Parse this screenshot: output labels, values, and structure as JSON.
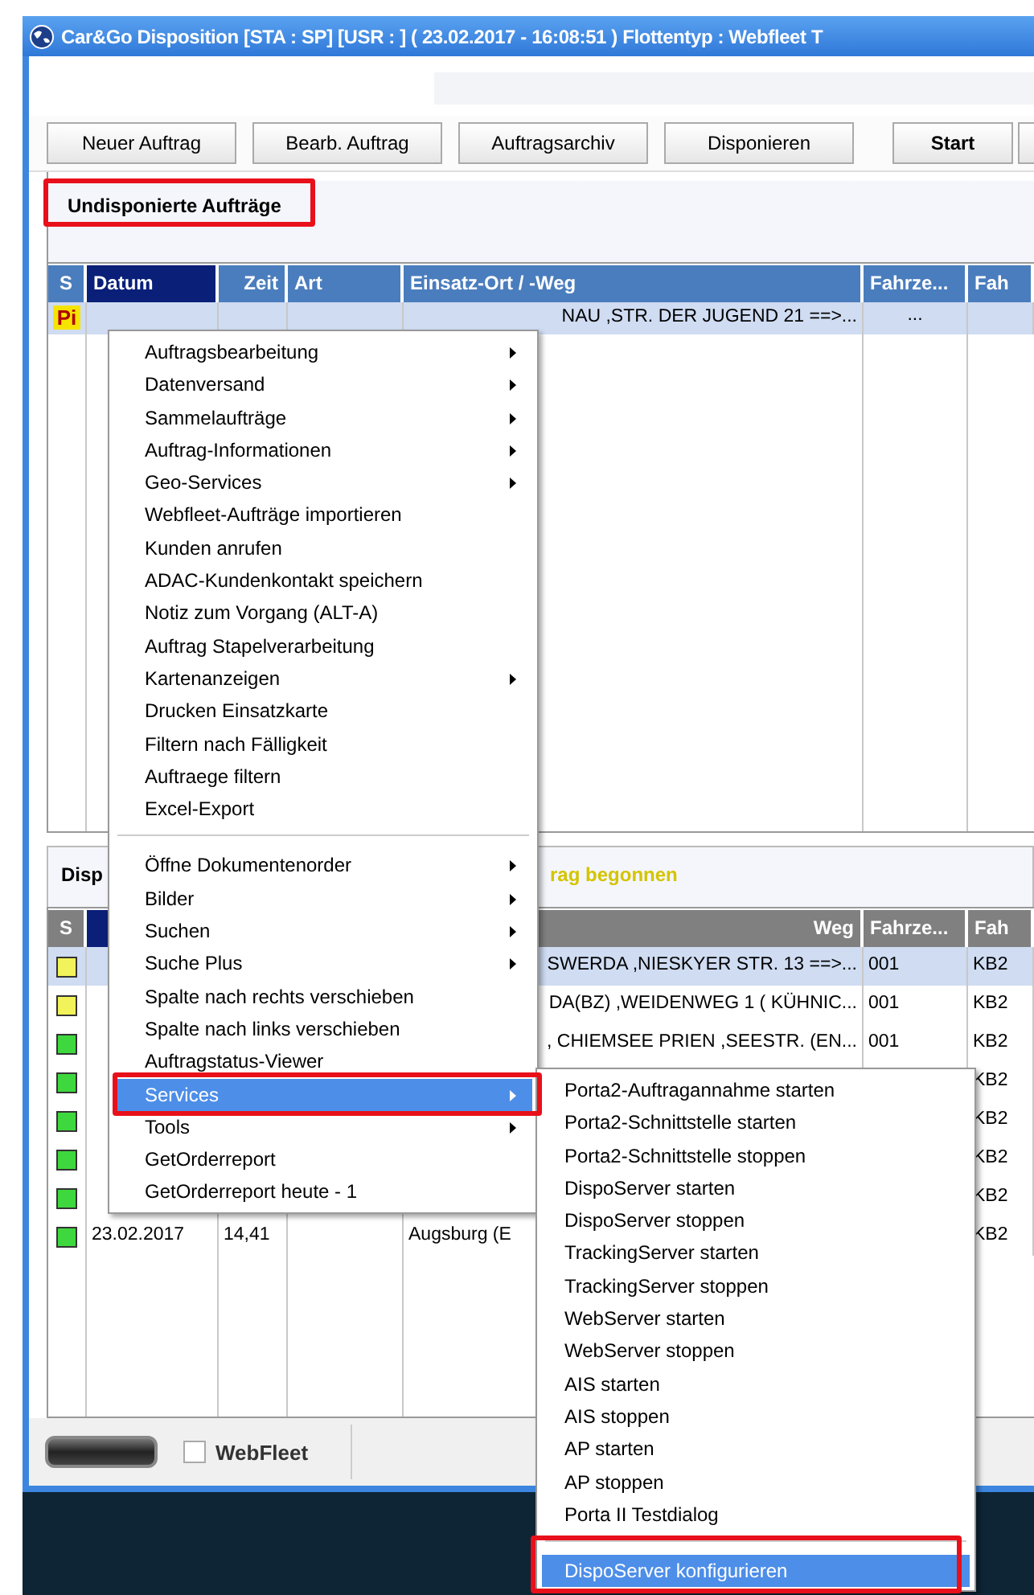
{
  "window": {
    "title": "Car&Go Disposition   [STA : SP]  [USR : ] ( 23.02.2017 - 16:08:51 ) Flottentyp : Webfleet T"
  },
  "toolbar": [
    {
      "label": "Neuer Auftrag",
      "kind": "normal"
    },
    {
      "label": "Bearb. Auftrag",
      "kind": "normal"
    },
    {
      "label": "Auftragsarchiv",
      "kind": "normal"
    },
    {
      "label": "Disponieren",
      "kind": "normal"
    },
    {
      "label": "Start",
      "kind": "primary"
    }
  ],
  "undispatched": {
    "title": "Undisponierte Aufträge",
    "columns": [
      {
        "label": "S",
        "selected": false
      },
      {
        "label": "Datum",
        "selected": true
      },
      {
        "label": "Zeit",
        "selected": false
      },
      {
        "label": "Art",
        "selected": false
      },
      {
        "label": "Einsatz-Ort / -Weg",
        "selected": false
      },
      {
        "label": "Fahrze...",
        "selected": false
      },
      {
        "label": "Fah",
        "selected": false
      }
    ],
    "rows": [
      {
        "status": "Pi",
        "ort": "NAU ,STR. DER JUGEND 21 ==>...",
        "fahrzeug": "...",
        "selected": true
      }
    ]
  },
  "dispatched": {
    "title": "Disp",
    "subtitle": "rag begonnen",
    "columns": [
      {
        "label": "S",
        "selected": false
      },
      {
        "selected": true
      },
      {},
      {},
      {
        "label": "Weg",
        "selected": false
      },
      {
        "label": "Fahrze...",
        "selected": false
      },
      {
        "label": "Fah",
        "selected": false
      }
    ],
    "rows": [
      {
        "color": "#f2f25a",
        "ort": "SWERDA ,NIESKYER STR. 13 ==>...",
        "fahrzeug": "001",
        "column_7": "KB2",
        "selected": true
      },
      {
        "color": "#f2f25a",
        "ort": "DA(BZ) ,WEIDENWEG 1 ( KÜHNIC...",
        "fahrzeug": "001",
        "column_7": "KB2",
        "selected": false
      },
      {
        "color": "#3ed83e",
        "ort": ", CHIEMSEE PRIEN ,SEESTR. (EN...",
        "fahrzeug": "001",
        "column_7": "KB2",
        "selected": false
      },
      {
        "color": "#3ed83e",
        "column_7": "KB2",
        "selected": false
      },
      {
        "color": "#3ed83e",
        "column_7": "KB2",
        "selected": false
      },
      {
        "color": "#3ed83e",
        "column_7": "KB2",
        "selected": false
      },
      {
        "color": "#3ed83e",
        "column_7": "KB2",
        "selected": false
      },
      {
        "color": "#3ed83e",
        "datum": "23.02.2017",
        "zeit": "14,41",
        "ort": "Augsburg (E",
        "column_7": "KB2",
        "selected": false
      }
    ]
  },
  "status_bar": {
    "checkbox": {
      "label": "WebFleet",
      "checked": false
    }
  },
  "context_menu": {
    "groups": [
      [
        {
          "label": "Auftragsbearbeitung",
          "submenu": true,
          "selected": false
        },
        {
          "label": "Datenversand",
          "submenu": true,
          "selected": false
        },
        {
          "label": "Sammelaufträge",
          "submenu": true,
          "selected": false
        },
        {
          "label": "Auftrag-Informationen",
          "submenu": true,
          "selected": false
        },
        {
          "label": "Geo-Services",
          "submenu": true,
          "selected": false
        },
        {
          "label": "Webfleet-Aufträge importieren",
          "submenu": false,
          "selected": false
        },
        {
          "label": "Kunden anrufen",
          "submenu": false,
          "selected": false
        },
        {
          "label": "ADAC-Kundenkontakt speichern",
          "submenu": false,
          "selected": false
        },
        {
          "label": "Notiz zum Vorgang (ALT-A)",
          "submenu": false,
          "selected": false
        },
        {
          "label": "Auftrag Stapelverarbeitung",
          "submenu": false,
          "selected": false
        },
        {
          "label": "Kartenanzeigen",
          "submenu": true,
          "selected": false
        },
        {
          "label": "Drucken Einsatzkarte",
          "submenu": false,
          "selected": false
        },
        {
          "label": "Filtern nach Fälligkeit",
          "submenu": false,
          "selected": false
        },
        {
          "label": "Auftraege filtern",
          "submenu": false,
          "selected": false
        },
        {
          "label": "Excel-Export",
          "submenu": false,
          "selected": false
        }
      ],
      [
        {
          "label": "Öffne Dokumentenorder",
          "submenu": true,
          "selected": false
        },
        {
          "label": "Bilder",
          "submenu": true,
          "selected": false
        },
        {
          "label": "Suchen",
          "submenu": true,
          "selected": false
        },
        {
          "label": "Suche Plus",
          "submenu": true,
          "selected": false
        },
        {
          "label": "Spalte nach rechts verschieben",
          "submenu": false,
          "selected": false
        },
        {
          "label": "Spalte nach links verschieben",
          "submenu": false,
          "selected": false
        },
        {
          "label": "Auftragstatus-Viewer",
          "submenu": false,
          "selected": false
        },
        {
          "label": "Services",
          "submenu": true,
          "selected": true
        },
        {
          "label": "Tools",
          "submenu": true,
          "selected": false
        },
        {
          "label": "GetOrderreport",
          "submenu": false,
          "selected": false
        },
        {
          "label": "GetOrderreport heute - 1",
          "submenu": false,
          "selected": false
        }
      ]
    ]
  },
  "services_menu": {
    "groups": [
      [
        {
          "label": "Porta2-Auftragannahme starten",
          "selected": false
        },
        {
          "label": "Porta2-Schnittstelle starten",
          "selected": false
        },
        {
          "label": "Porta2-Schnittstelle stoppen",
          "selected": false
        },
        {
          "label": "DispoServer starten",
          "selected": false
        },
        {
          "label": "DispoServer stoppen",
          "selected": false
        },
        {
          "label": "TrackingServer starten",
          "selected": false
        },
        {
          "label": "TrackingServer stoppen",
          "selected": false
        },
        {
          "label": "WebServer starten",
          "selected": false
        },
        {
          "label": "WebServer stoppen",
          "selected": false
        },
        {
          "label": "AIS starten",
          "selected": false
        },
        {
          "label": "AIS stoppen",
          "selected": false
        },
        {
          "label": "AP starten",
          "selected": false
        },
        {
          "label": "AP stoppen",
          "selected": false
        },
        {
          "label": "Porta II Testdialog",
          "selected": false
        }
      ],
      [
        {
          "label": "DispoServer konfigurieren",
          "selected": true
        }
      ]
    ]
  }
}
